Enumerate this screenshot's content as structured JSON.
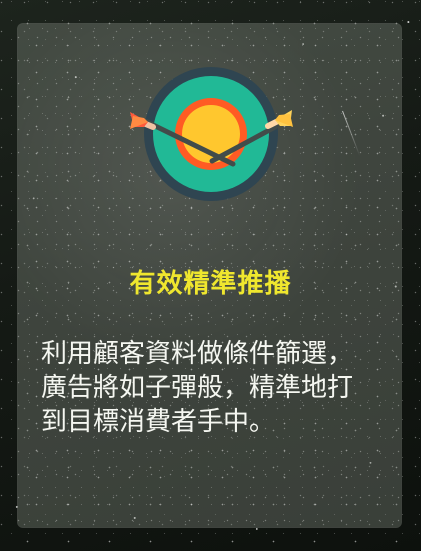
{
  "card": {
    "title": "有效精準推播",
    "description_lines": [
      "利用顧客資料做條件篩選，",
      "廣告將如子彈般，精準地打",
      "到目標消費者手中。"
    ]
  },
  "icons": {
    "target": "target-icon"
  },
  "colors": {
    "title": "#efe72e",
    "body_text": "#f5f7f1",
    "target_outer_ring": "#2f4551",
    "target_teal_ring": "#21b996",
    "target_orange_ring": "#ff5b24",
    "target_center": "#ffc72e",
    "arrow_head_left": "#e9b9b2",
    "arrow_head_right": "#ffd8a8",
    "arrow_fletching": "#ff6b3b"
  }
}
